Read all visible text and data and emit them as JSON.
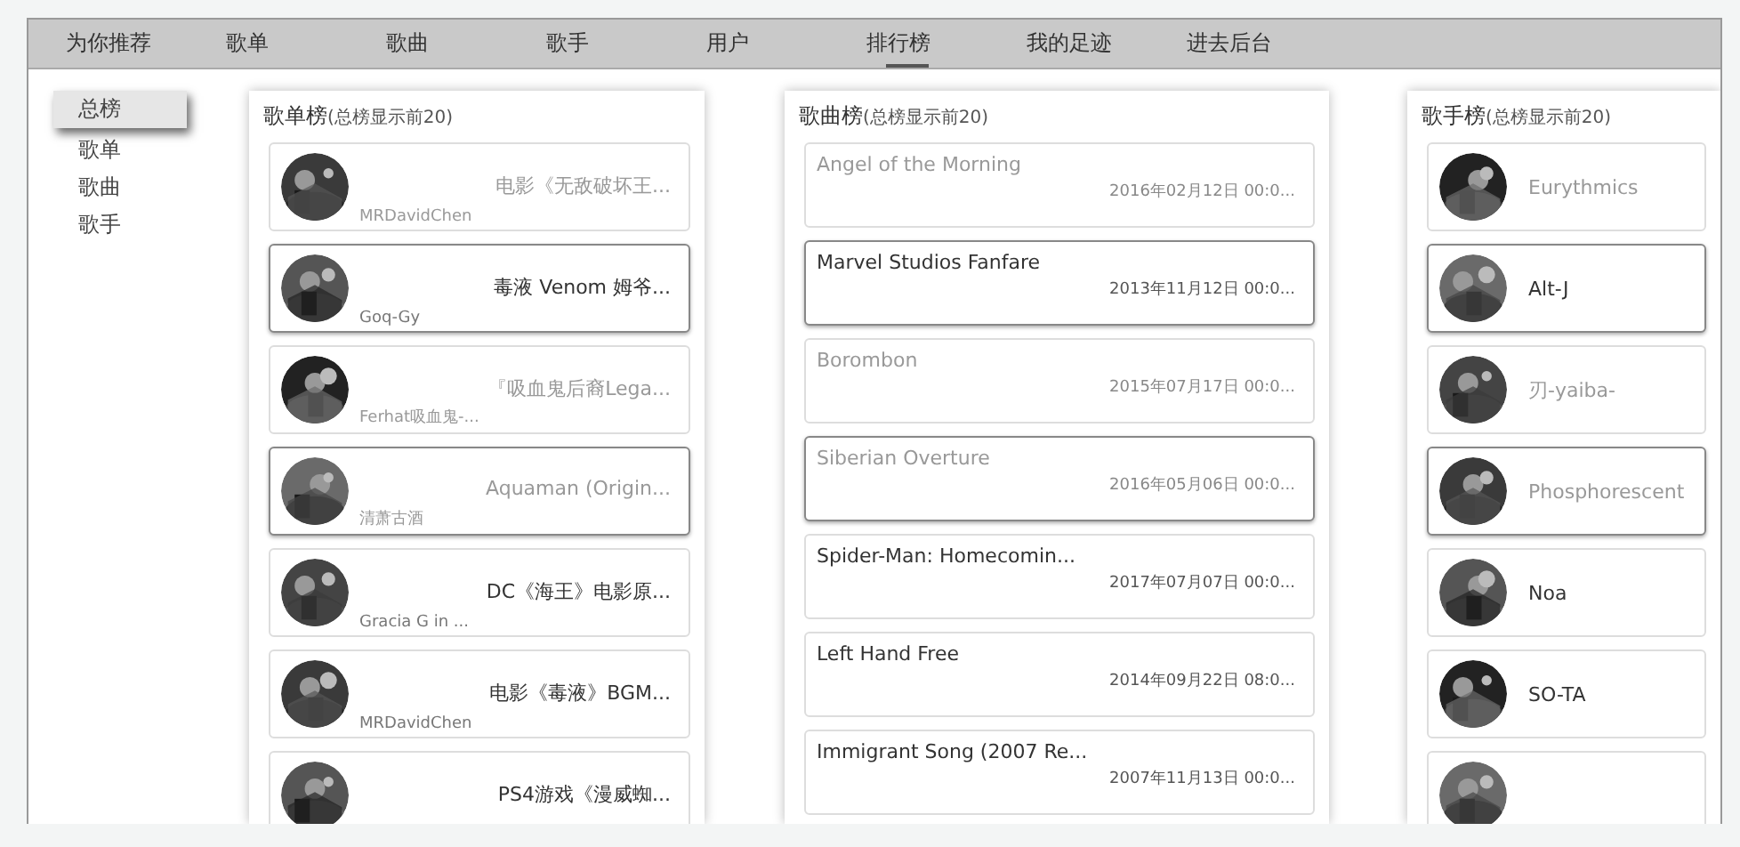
{
  "nav": [
    {
      "label": "为你推荐",
      "selected": false
    },
    {
      "label": "歌单",
      "selected": false
    },
    {
      "label": "歌曲",
      "selected": false
    },
    {
      "label": "歌手",
      "selected": false
    },
    {
      "label": "用户",
      "selected": false
    },
    {
      "label": "排行榜",
      "selected": true
    },
    {
      "label": "我的足迹",
      "selected": false
    },
    {
      "label": "进去后台",
      "selected": false
    }
  ],
  "sidebar": {
    "items": [
      {
        "label": "总榜",
        "selected": true
      },
      {
        "label": "歌单",
        "selected": false
      },
      {
        "label": "歌曲",
        "selected": false
      },
      {
        "label": "歌手",
        "selected": false
      }
    ]
  },
  "panels": [
    {
      "kind": "playlist",
      "title": "歌单榜",
      "subtitle": "(总榜显示前20)",
      "items": [
        {
          "title": "电影《无敌破坏王...",
          "user": "MRDavidChen",
          "dimmed": true,
          "highlighted": false
        },
        {
          "title": "毒液 Venom 姆爷...",
          "user": "Goq-Gy",
          "dimmed": false,
          "highlighted": true
        },
        {
          "title": "『吸血鬼后裔Lega...",
          "user": "Ferhat吸血鬼-...",
          "dimmed": true,
          "highlighted": false
        },
        {
          "title": "Aquaman (Origin...",
          "user": "清萧古酒",
          "dimmed": true,
          "highlighted": true
        },
        {
          "title": "DC《海王》电影原...",
          "user": "Gracia G in ...",
          "dimmed": false,
          "highlighted": false
        },
        {
          "title": "电影《毒液》BGM...",
          "user": "MRDavidChen",
          "dimmed": false,
          "highlighted": false
        },
        {
          "title": "PS4游戏《漫威蜘...",
          "dimmed": false,
          "highlighted": false
        }
      ]
    },
    {
      "kind": "song",
      "title": "歌曲榜",
      "subtitle": "(总榜显示前20)",
      "items": [
        {
          "title": "Angel of the Morning",
          "date": "2016年02月12日 00:0...",
          "dimmed": true,
          "highlighted": false
        },
        {
          "title": "Marvel Studios Fanfare",
          "date": "2013年11月12日 00:0...",
          "dimmed": false,
          "highlighted": true
        },
        {
          "title": "Borombon",
          "date": "2015年07月17日 00:0...",
          "dimmed": true,
          "highlighted": false
        },
        {
          "title": "Siberian Overture",
          "date": "2016年05月06日 00:0...",
          "dimmed": true,
          "highlighted": true
        },
        {
          "title": "Spider-Man: Homecomin...",
          "date": "2017年07月07日 00:0...",
          "dimmed": false,
          "highlighted": false
        },
        {
          "title": "Left Hand Free",
          "date": "2014年09月22日 08:0...",
          "dimmed": false,
          "highlighted": false
        },
        {
          "title": "Immigrant Song (2007 Re...",
          "date": "2007年11月13日 00:0...",
          "dimmed": false,
          "highlighted": false
        }
      ]
    },
    {
      "kind": "singer",
      "title": "歌手榜",
      "subtitle": "(总榜显示前20)",
      "items": [
        {
          "name": "Eurythmics",
          "dimmed": true,
          "highlighted": false
        },
        {
          "name": "Alt-J",
          "dimmed": false,
          "highlighted": true
        },
        {
          "name": "刃-yaiba-",
          "dimmed": true,
          "highlighted": false
        },
        {
          "name": "Phosphorescent",
          "dimmed": true,
          "highlighted": true
        },
        {
          "name": "Noa",
          "dimmed": false,
          "highlighted": false
        },
        {
          "name": "SO-TA",
          "dimmed": false,
          "highlighted": false
        },
        {
          "highlighted": false
        }
      ]
    }
  ]
}
